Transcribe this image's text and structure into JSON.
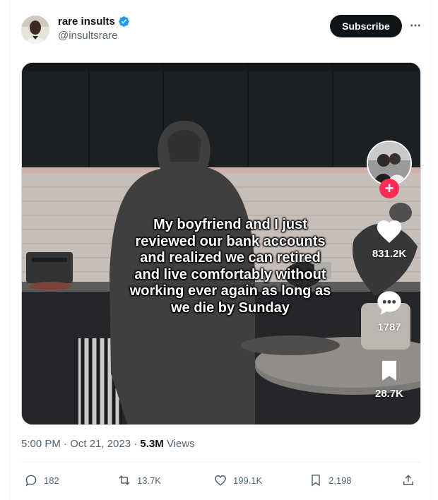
{
  "author": {
    "display_name": "rare insults",
    "handle": "@insultsrare",
    "verified_icon": "verified-badge-icon",
    "subscribe_label": "Subscribe",
    "more_icon": "more-horizontal-icon"
  },
  "video": {
    "caption": "My boyfriend and I just reviewed our bank accounts and realized we can retired and live comfortably without working ever again as long as we die by Sunday",
    "follow_icon": "plus-icon",
    "likes": "831.2K",
    "comments": "1787",
    "saves": "28.7K",
    "like_icon": "heart-icon",
    "comment_icon": "comment-bubble-icon",
    "save_icon": "bookmark-icon"
  },
  "meta": {
    "timestamp": "5:00 PM · Oct 21, 2023 · ",
    "views_count": "5.3M",
    "views_label": " Views"
  },
  "actions": {
    "replies": "182",
    "reposts": "13.7K",
    "likes": "199.1K",
    "bookmarks": "2,198",
    "reply_icon": "reply-icon",
    "repost_icon": "repost-icon",
    "like_icon": "heart-outline-icon",
    "bookmark_icon": "bookmark-outline-icon",
    "share_icon": "share-icon"
  },
  "colors": {
    "text_primary": "#0f1419",
    "text_secondary": "#536471",
    "verified_blue": "#1d9bf0",
    "tiktok_red": "#fe2c55"
  }
}
